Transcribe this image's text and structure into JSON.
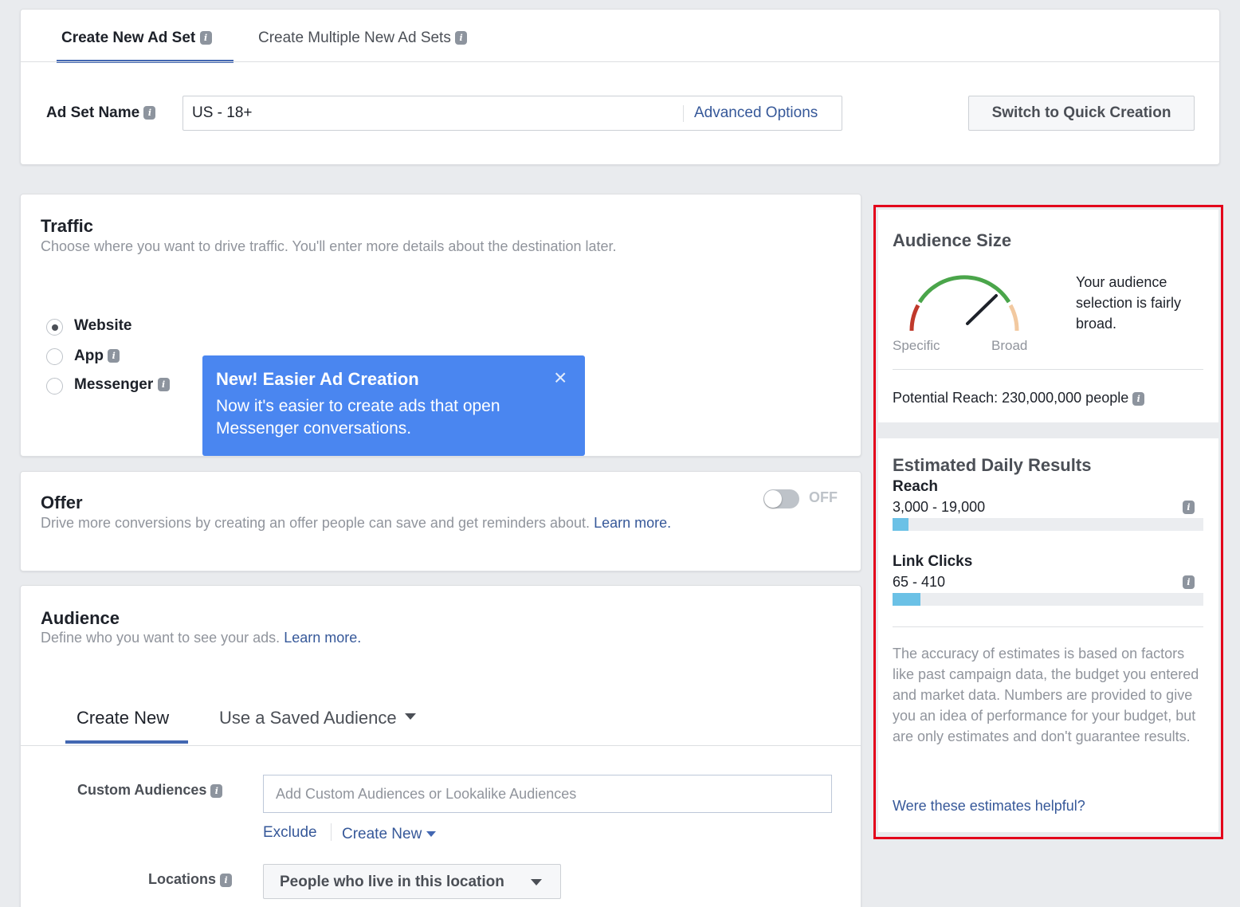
{
  "tabs": {
    "create_new_ad_set": "Create New Ad Set",
    "create_multiple": "Create Multiple New Ad Sets"
  },
  "ad_set": {
    "name_label": "Ad Set Name",
    "name_value": "US - 18+",
    "advanced_options": "Advanced Options",
    "switch_quick": "Switch to Quick Creation"
  },
  "traffic": {
    "title": "Traffic",
    "description": "Choose where you want to drive traffic. You'll enter more details about the destination later.",
    "options": [
      {
        "label": "Website",
        "selected": true
      },
      {
        "label": "App",
        "selected": false
      },
      {
        "label": "Messenger",
        "selected": false
      }
    ]
  },
  "tooltip": {
    "title": "New! Easier Ad Creation",
    "body": "Now it's easier to create ads that open Messenger conversations.",
    "close": "×"
  },
  "offer": {
    "title": "Offer",
    "description": "Drive more conversions by creating an offer people can save and get reminders about.",
    "learn_more_1": "Learn",
    "learn_more_2": "more.",
    "toggle_state": "OFF"
  },
  "audience": {
    "title": "Audience",
    "description": "Define who you want to see your ads.",
    "learn_more": "Learn more.",
    "tab_create_new": "Create New",
    "tab_saved": "Use a Saved Audience",
    "custom_audiences_label": "Custom Audiences",
    "custom_audiences_placeholder": "Add Custom Audiences or Lookalike Audiences",
    "exclude": "Exclude",
    "create_new_link": "Create New",
    "locations_label": "Locations",
    "locations_value": "People who live in this location"
  },
  "audience_size": {
    "title": "Audience Size",
    "specific": "Specific",
    "broad": "Broad",
    "description": "Your audience selection is fairly broad.",
    "potential_reach": "Potential Reach: 230,000,000 people",
    "gauge_level": 0.62
  },
  "daily_results": {
    "title": "Estimated Daily Results",
    "reach_label": "Reach",
    "reach_value": "3,000 - 19,000",
    "reach_fill": 0.05,
    "clicks_label": "Link Clicks",
    "clicks_value": "65 - 410",
    "clicks_fill": 0.09,
    "disclaimer": "The accuracy of estimates is based on factors like past campaign data, the budget you entered and market data. Numbers are provided to give you an idea of performance for your budget, but are only estimates and don't guarantee results.",
    "helpful_link": "Were these estimates helpful?"
  },
  "colors": {
    "highlight_border": "#e3001b",
    "tooltip_bg": "#4a86f0",
    "bar_fill": "#6bc1e6",
    "gauge_green": "#4aa54a",
    "gauge_red": "#c0392b",
    "gauge_peach": "#f2c9a0"
  }
}
